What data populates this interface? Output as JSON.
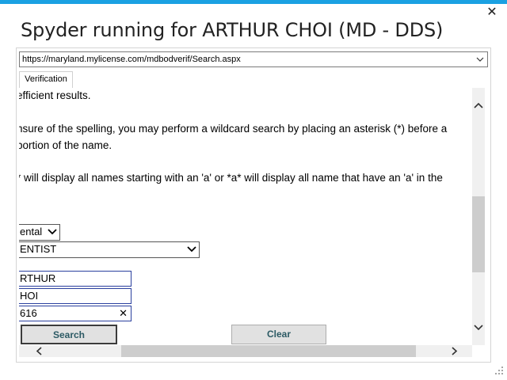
{
  "window": {
    "title": "Spyder running for ARTHUR CHOI (MD - DDS)",
    "close_glyph": "✕"
  },
  "address": {
    "url": "https://maryland.mylicense.com/mdbodverif/Search.aspx"
  },
  "tabs": [
    {
      "label": "Verification"
    }
  ],
  "content": {
    "lines": [
      "efficient results.",
      "nsure of the spelling, you may perform a wildcard search by placing an asterisk (*) before a",
      "portion of the name.",
      "* will display all names starting with an 'a' or *a* will display all name that have an 'a' in the"
    ],
    "board_select": "ental",
    "profession_select": "ENTIST",
    "first_name": "RTHUR",
    "last_name": "HOI",
    "license_number": "616",
    "clear_field_glyph": "✕"
  },
  "buttons": {
    "search": "Search",
    "clear": "Clear"
  },
  "scrollbars": {
    "up": "^",
    "down": "v",
    "left": "<",
    "right": ">"
  },
  "colors": {
    "accent": "#1ba1e2",
    "button_text": "#2c5a64",
    "input_border": "#2a3f9e"
  }
}
